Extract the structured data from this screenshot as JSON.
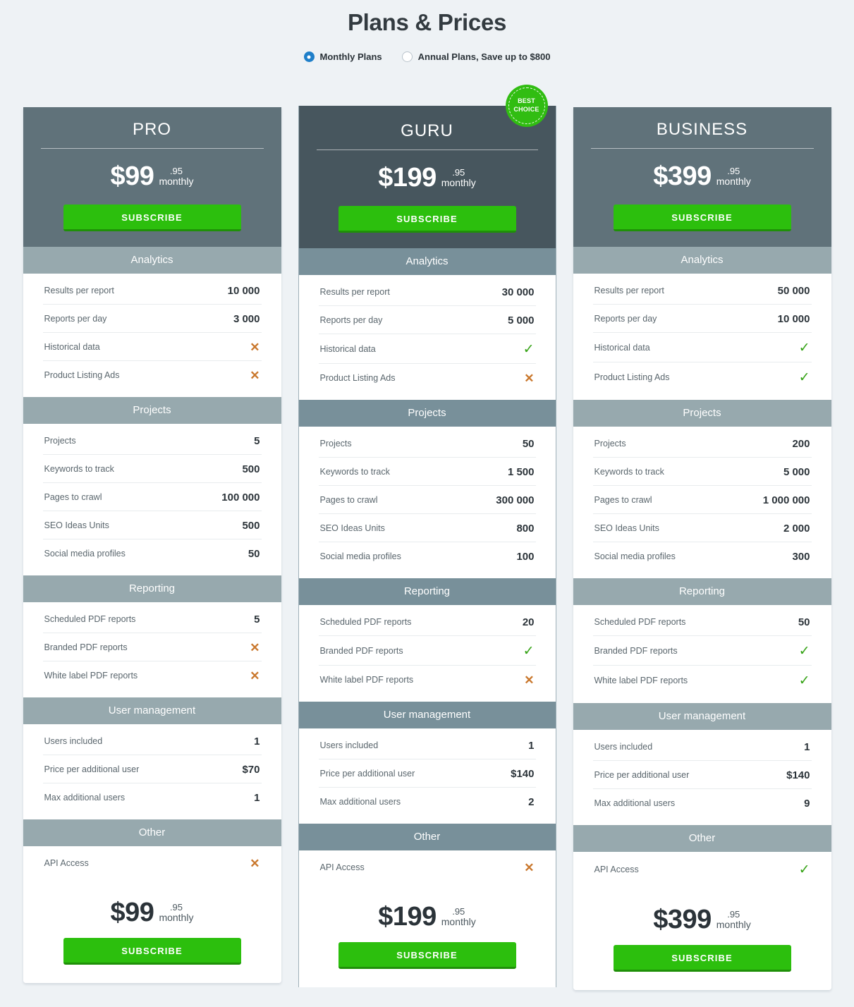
{
  "page": {
    "title": "Plans & Prices"
  },
  "billing_toggle": {
    "options": [
      {
        "label": "Monthly Plans",
        "selected": true
      },
      {
        "label": "Annual Plans, Save up to $800",
        "selected": false
      }
    ]
  },
  "badge": {
    "line1": "BEST",
    "line2": "CHOICE"
  },
  "subscribe_label": "SUBSCRIBE",
  "price_cents": ".95",
  "price_period": "monthly",
  "section_titles": {
    "analytics": "Analytics",
    "projects": "Projects",
    "reporting": "Reporting",
    "user_management": "User management",
    "other": "Other"
  },
  "feature_labels": {
    "analytics": [
      "Results per report",
      "Reports per day",
      "Historical data",
      "Product Listing Ads"
    ],
    "projects": [
      "Projects",
      "Keywords to track",
      "Pages to crawl",
      "SEO Ideas Units",
      "Social media profiles"
    ],
    "reporting": [
      "Scheduled PDF reports",
      "Branded PDF reports",
      "White label PDF reports"
    ],
    "user_management": [
      "Users included",
      "Price per additional user",
      "Max additional users"
    ],
    "other": [
      "API Access"
    ]
  },
  "marks": {
    "yes": "✓",
    "no": "✕"
  },
  "plans": [
    {
      "name": "PRO",
      "price": "$99",
      "featured": false,
      "analytics": [
        "10 000",
        "3 000",
        "no",
        "no"
      ],
      "projects": [
        "5",
        "500",
        "100 000",
        "500",
        "50"
      ],
      "reporting": [
        "5",
        "no",
        "no"
      ],
      "user_management": [
        "1",
        "$70",
        "1"
      ],
      "other": [
        "no"
      ]
    },
    {
      "name": "GURU",
      "price": "$199",
      "featured": true,
      "analytics": [
        "30 000",
        "5 000",
        "yes",
        "no"
      ],
      "projects": [
        "50",
        "1 500",
        "300 000",
        "800",
        "100"
      ],
      "reporting": [
        "20",
        "yes",
        "no"
      ],
      "user_management": [
        "1",
        "$140",
        "2"
      ],
      "other": [
        "no"
      ]
    },
    {
      "name": "BUSINESS",
      "price": "$399",
      "featured": false,
      "analytics": [
        "50 000",
        "10 000",
        "yes",
        "yes"
      ],
      "projects": [
        "200",
        "5 000",
        "1 000 000",
        "2 000",
        "300"
      ],
      "reporting": [
        "50",
        "yes",
        "yes"
      ],
      "user_management": [
        "1",
        "$140",
        "9"
      ],
      "other": [
        "yes"
      ]
    }
  ],
  "colors": {
    "page_bg": "#eef2f5",
    "card_head": "#60727a",
    "card_head_featured": "#47565e",
    "section_head": "#97a9ae",
    "section_head_featured": "#78909a",
    "accent_green": "#2cbf0d",
    "badge_green": "#31bd12",
    "radio_blue": "#1f7fc9",
    "mark_yes": "#34a214",
    "mark_no": "#c9772c"
  }
}
